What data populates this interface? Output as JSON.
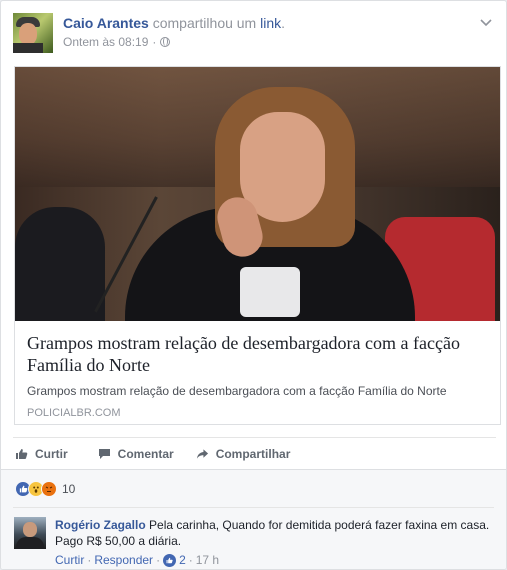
{
  "post": {
    "author": "Caio Arantes",
    "action": "compartilhou um",
    "link_word": "link",
    "link_dot": ".",
    "timestamp": "Ontem às 08:19",
    "separator": "·"
  },
  "link_preview": {
    "title": "Grampos mostram relação de desembargadora com a facção Família do Norte",
    "description": "Grampos mostram relação de desembargadora com a facção Família do Norte",
    "domain": "POLICIALBR.COM"
  },
  "actions": {
    "like": "Curtir",
    "comment": "Comentar",
    "share": "Compartilhar"
  },
  "reactions": {
    "count": "10",
    "types": [
      "like",
      "wow",
      "angry"
    ]
  },
  "comment": {
    "author": "Rogério Zagallo",
    "text": "Pela carinha, Quando for demitida poderá fazer faxina em casa. Pago R$ 50,00 a diária.",
    "like_label": "Curtir",
    "reply_label": "Responder",
    "dot": "·",
    "like_count": "2",
    "time": "17 h"
  },
  "colors": {
    "brand_blue": "#365899",
    "like_blue": "#4267b2",
    "muted_gray": "#90949c",
    "background": "#e9ebee"
  },
  "icons": [
    "globe-icon",
    "chevron-down-icon",
    "thumbs-up-icon",
    "comment-icon",
    "share-icon",
    "like-reaction-icon",
    "wow-reaction-icon",
    "angry-reaction-icon"
  ]
}
